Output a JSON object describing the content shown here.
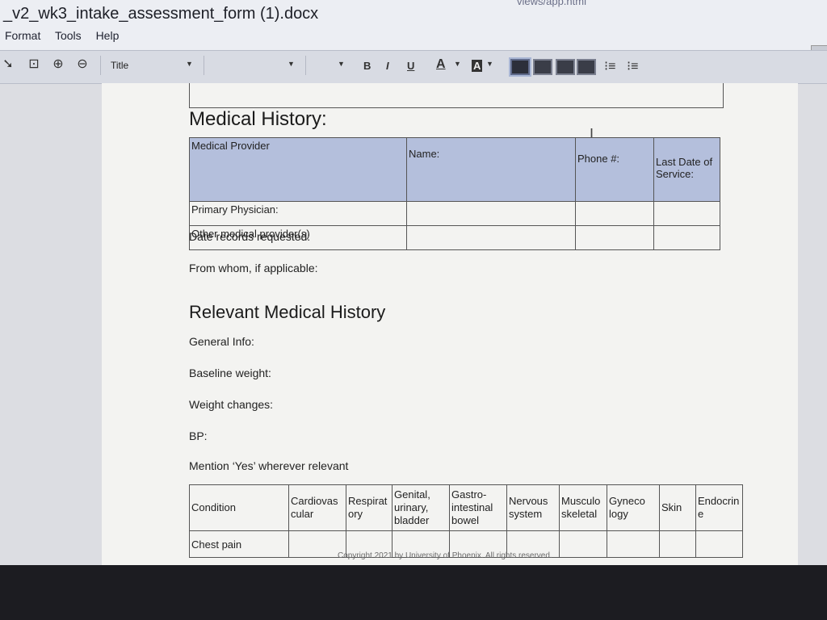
{
  "window": {
    "title": "_v2_wk3_intake_assessment_form (1).docx",
    "url_fragment": "views/app.html"
  },
  "menu": [
    "Format",
    "Tools",
    "Help"
  ],
  "toolbar": {
    "style_value": "Title",
    "bold": "B",
    "italic": "I",
    "underline": "U",
    "font_color": "A",
    "highlight": "A"
  },
  "document": {
    "medical_history_heading": "Medical History:",
    "provider_table": {
      "headers": [
        "Medical Provider",
        "Name:",
        "Phone #:",
        "Last Date of Service:"
      ],
      "rows": [
        [
          "Primary Physician:",
          "",
          "",
          ""
        ],
        [
          "Other medical provider(s)",
          "",
          "",
          ""
        ]
      ]
    },
    "date_records": "Date records requested:",
    "from_whom": "From whom, if applicable:",
    "relevant_heading": "Relevant Medical History",
    "general_info": "General Info:",
    "baseline_weight": "Baseline weight:",
    "weight_changes": "Weight changes:",
    "bp": "BP:",
    "mention_yes": "Mention ‘Yes’ wherever relevant",
    "condition_table": {
      "headers": [
        "Condition",
        "Cardiovas cular",
        "Respirat ory",
        "Genital, urinary, bladder",
        "Gastro-intestinal bowel",
        "Nervous system",
        "Musculo skeletal",
        "Gyneco logy",
        "Skin",
        "Endocrin e"
      ],
      "rows": [
        [
          "Chest pain",
          "",
          "",
          "",
          "",
          "",
          "",
          "",
          "",
          ""
        ]
      ]
    },
    "copyright": "Copyright 2021 by University of Phoenix. All rights reserved."
  }
}
